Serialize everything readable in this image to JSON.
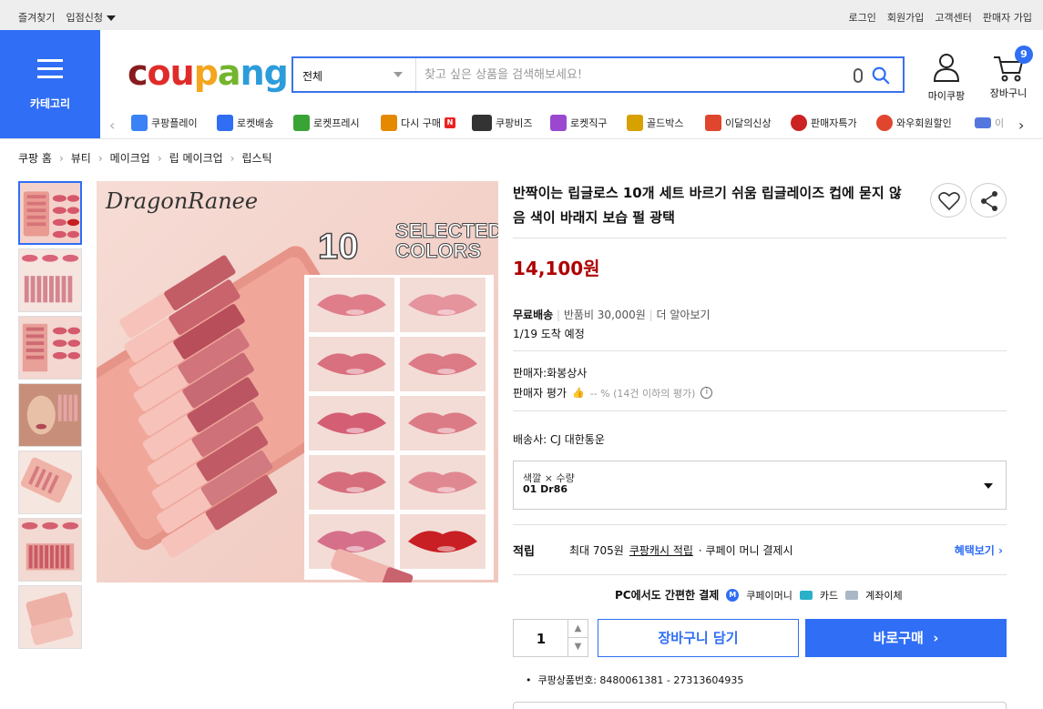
{
  "topbar": {
    "favorites": "즐겨찾기",
    "vendor_apply": "입점신청",
    "login": "로그인",
    "signup": "회원가입",
    "customer_center": "고객센터",
    "seller_join": "판매자 가입"
  },
  "category_button": {
    "label": "카테고리"
  },
  "logo": {
    "c": "c",
    "ou": "ou",
    "p": "p",
    "a": "a",
    "ng": "ng"
  },
  "search": {
    "category": "전체",
    "placeholder": "찾고 싶은 상품을 검색해보세요!"
  },
  "header": {
    "mycoupang": "마이쿠팡",
    "cart": "장바구니",
    "cart_count": "9"
  },
  "catnav": [
    {
      "label": "쿠팡플레이",
      "icon": "coupang-play-icon",
      "color": "#3b82f6"
    },
    {
      "label": "로켓배송",
      "icon": "rocket-delivery-icon",
      "color": "#2f6ef5"
    },
    {
      "label": "로켓프레시",
      "icon": "rocket-fresh-icon",
      "color": "#3aa335"
    },
    {
      "label": "다시 구매",
      "icon": "rebuy-icon",
      "color": "#e58a00"
    },
    {
      "label": "쿠팡비즈",
      "icon": "biz-icon",
      "color": "#333333"
    },
    {
      "label": "로켓직구",
      "icon": "rocket-direct-icon",
      "color": "#9a48d0"
    },
    {
      "label": "골드박스",
      "icon": "goldbox-icon",
      "color": "#d7a100"
    },
    {
      "label": "이달의신상",
      "icon": "new-icon",
      "color": "#e0462e"
    },
    {
      "label": "판매자특가",
      "icon": "seller-deal-icon",
      "color": "#cc2222"
    },
    {
      "label": "와우회원할인",
      "icon": "wow-icon",
      "color": "#e0462e"
    },
    {
      "label": "이",
      "icon": "coupon-icon",
      "color": "#5577dd"
    }
  ],
  "breadcrumb": [
    "쿠팡 홈",
    "뷰티",
    "메이크업",
    "립 메이크업",
    "립스틱"
  ],
  "product": {
    "title": "반짝이는 립글로스 10개 세트 바르기 쉬움 립글레이즈 컵에 묻지 않음 색이 바래지 보습 펄 광택",
    "price": "14,100원",
    "shipping_free": "무료배송",
    "return_fee": "반품비 30,000원",
    "learn_more": "더 알아보기",
    "arrival": "1/19 도착 예정",
    "seller": "판매자:화봉상사",
    "seller_rating_label": "판매자 평가",
    "seller_rating_value": "-- % (14건 이하의 평가)",
    "carrier": "배송사:  CJ 대한통운",
    "option_label": "색깔 × 수량",
    "option_value": "01 Dr86",
    "reward_label": "적립",
    "reward_max": "최대 705원",
    "reward_cash": "쿠팡캐시 적립",
    "reward_pay": "· 쿠페이 머니 결제시",
    "benefit": "혜택보기",
    "pay_easy": "PC에서도 간편한 결제",
    "pay_money": "쿠페이머니",
    "pay_card": "카드",
    "pay_transfer": "계좌이체",
    "quantity": "1",
    "add_cart": "장바구니 담기",
    "buy_now": "바로구매",
    "product_number": "쿠팡상품번호: 8480061381 - 27313604935"
  },
  "image": {
    "brand": "DragonRanee",
    "headline_num": "10",
    "headline_1": "SELECTED",
    "headline_2": "COLORS"
  }
}
